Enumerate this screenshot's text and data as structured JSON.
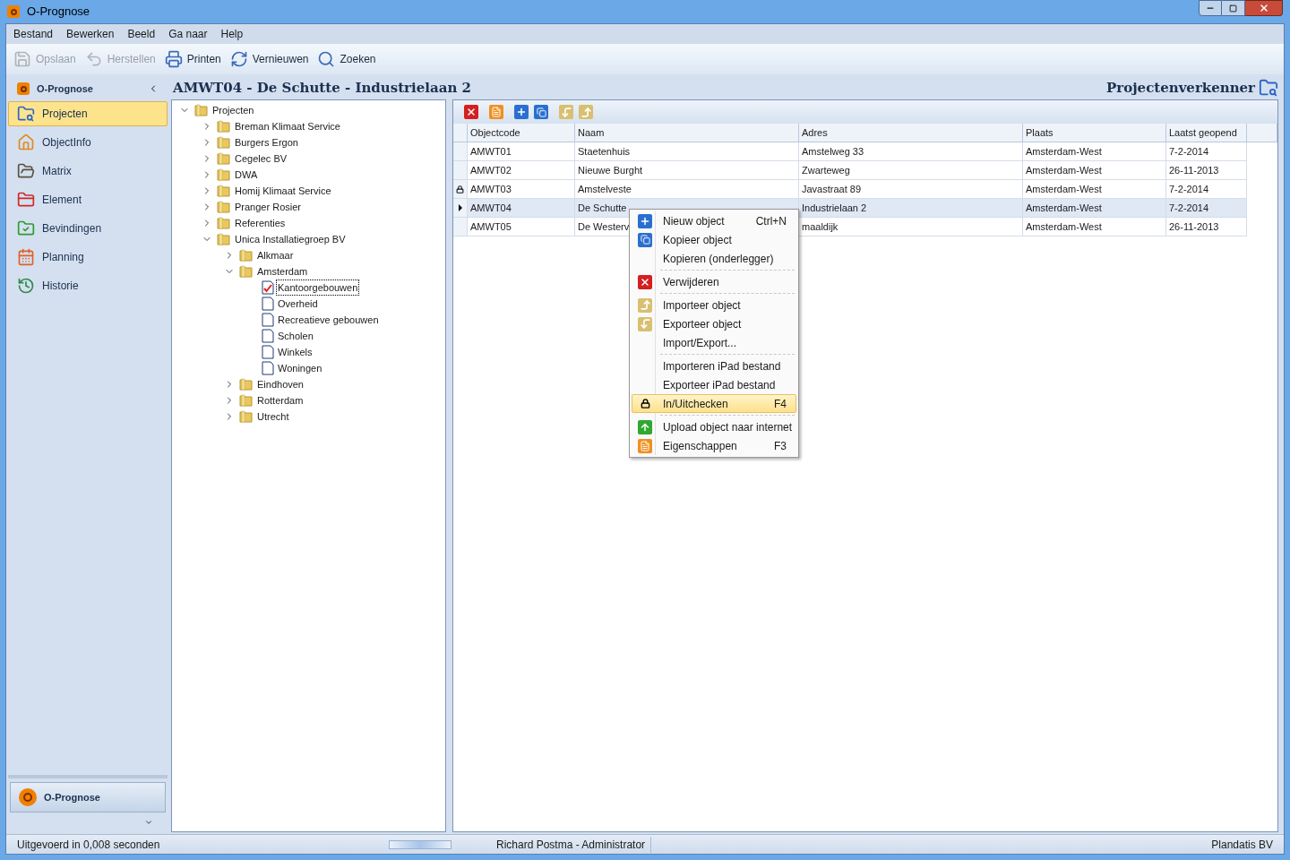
{
  "window": {
    "title": "O-Prognose"
  },
  "menu_bar": [
    "Bestand",
    "Bewerken",
    "Beeld",
    "Ga naar",
    "Help"
  ],
  "toolbar": [
    {
      "label": "Opslaan",
      "disabled": true
    },
    {
      "label": "Herstellen",
      "disabled": true
    },
    {
      "label": "Printen",
      "disabled": false
    },
    {
      "label": "Vernieuwen",
      "disabled": false
    },
    {
      "label": "Zoeken",
      "disabled": false
    }
  ],
  "nav": {
    "title": "O-Prognose",
    "items": [
      {
        "label": "Projecten",
        "selected": true
      },
      {
        "label": "ObjectInfo",
        "selected": false
      },
      {
        "label": "Matrix",
        "selected": false
      },
      {
        "label": "Element",
        "selected": false
      },
      {
        "label": "Bevindingen",
        "selected": false
      },
      {
        "label": "Planning",
        "selected": false
      },
      {
        "label": "Historie",
        "selected": false
      }
    ],
    "bottom_button": "O-Prognose"
  },
  "header": {
    "title": "AMWT04 - De Schutte - Industrielaan 2",
    "section": "Projectenverkenner"
  },
  "tree": [
    {
      "label": "Projecten",
      "kind": "folder",
      "expanded": true,
      "selected": false,
      "children": [
        {
          "label": "Breman Klimaat Service",
          "kind": "folder",
          "expanded": false,
          "selected": false
        },
        {
          "label": "Burgers Ergon",
          "kind": "folder",
          "expanded": false,
          "selected": false
        },
        {
          "label": "Cegelec BV",
          "kind": "folder",
          "expanded": false,
          "selected": false
        },
        {
          "label": "DWA",
          "kind": "folder",
          "expanded": false,
          "selected": false
        },
        {
          "label": "Homij Klimaat Service",
          "kind": "folder",
          "expanded": false,
          "selected": false
        },
        {
          "label": "Pranger Rosier",
          "kind": "folder",
          "expanded": false,
          "selected": false
        },
        {
          "label": "Referenties",
          "kind": "folder",
          "expanded": false,
          "selected": false
        },
        {
          "label": "Unica Installatiegroep BV",
          "kind": "folder",
          "expanded": true,
          "selected": false,
          "children": [
            {
              "label": "Alkmaar",
              "kind": "folder",
              "expanded": false,
              "selected": false
            },
            {
              "label": "Amsterdam",
              "kind": "folder",
              "expanded": true,
              "selected": false,
              "children": [
                {
                  "label": "Kantoorgebouwen",
                  "kind": "page",
                  "checked": true,
                  "selected": true
                },
                {
                  "label": "Overheid",
                  "kind": "page",
                  "checked": false,
                  "selected": false
                },
                {
                  "label": "Recreatieve gebouwen",
                  "kind": "page",
                  "checked": false,
                  "selected": false
                },
                {
                  "label": "Scholen",
                  "kind": "page",
                  "checked": false,
                  "selected": false
                },
                {
                  "label": "Winkels",
                  "kind": "page",
                  "checked": false,
                  "selected": false
                },
                {
                  "label": "Woningen",
                  "kind": "page",
                  "checked": false,
                  "selected": false
                }
              ]
            },
            {
              "label": "Eindhoven",
              "kind": "folder",
              "expanded": false,
              "selected": false
            },
            {
              "label": "Rotterdam",
              "kind": "folder",
              "expanded": false,
              "selected": false
            },
            {
              "label": "Utrecht",
              "kind": "folder",
              "expanded": false,
              "selected": false
            }
          ]
        }
      ]
    }
  ],
  "table": {
    "columns": [
      "Objectcode",
      "Naam",
      "Adres",
      "Plaats",
      "Laatst geopend"
    ],
    "rows": [
      {
        "cells": [
          "AMWT01",
          "Staetenhuis",
          "Amstelweg 33",
          "Amsterdam-West",
          "7-2-2014"
        ],
        "locked": false,
        "selected": false
      },
      {
        "cells": [
          "AMWT02",
          "Nieuwe Burght",
          "Zwarteweg",
          "Amsterdam-West",
          "26-11-2013"
        ],
        "locked": false,
        "selected": false
      },
      {
        "cells": [
          "AMWT03",
          "Amstelveste",
          "Javastraat 89",
          "Amsterdam-West",
          "7-2-2014"
        ],
        "locked": true,
        "selected": false
      },
      {
        "cells": [
          "AMWT04",
          "De Schutte",
          "Industrielaan 2",
          "Amsterdam-West",
          "7-2-2014"
        ],
        "locked": false,
        "selected": true
      },
      {
        "cells": [
          "AMWT05",
          "De Westerv",
          "maaldijk",
          "Amsterdam-West",
          "26-11-2013"
        ],
        "locked": false,
        "selected": false
      }
    ]
  },
  "context_menu": [
    {
      "label": "Nieuw object",
      "shortcut": "Ctrl+N",
      "separator": false,
      "selected": false
    },
    {
      "label": "Kopieer object",
      "separator": false,
      "selected": false
    },
    {
      "label": "Kopieren (onderlegger)",
      "separator": false,
      "selected": false
    },
    {
      "label": "Verwijderen",
      "separator": true,
      "selected": false
    },
    {
      "label": "Importeer object",
      "separator": true,
      "selected": false
    },
    {
      "label": "Exporteer object",
      "separator": false,
      "selected": false
    },
    {
      "label": "Import/Export...",
      "separator": false,
      "selected": false
    },
    {
      "label": "Importeren iPad bestand",
      "separator": true,
      "selected": false
    },
    {
      "label": "Exporteer iPad bestand",
      "separator": false,
      "selected": false
    },
    {
      "label": "In/Uitchecken",
      "shortcut": "F4",
      "separator": false,
      "selected": true
    },
    {
      "label": "Upload object naar internet",
      "separator": true,
      "selected": false
    },
    {
      "label": "Eigenschappen",
      "shortcut": "F3",
      "separator": false,
      "selected": false
    }
  ],
  "status_bar": {
    "left": "Uitgevoerd in 0,008 seconden",
    "center": "Richard Postma - Administrator",
    "right": "Plandatis BV"
  }
}
